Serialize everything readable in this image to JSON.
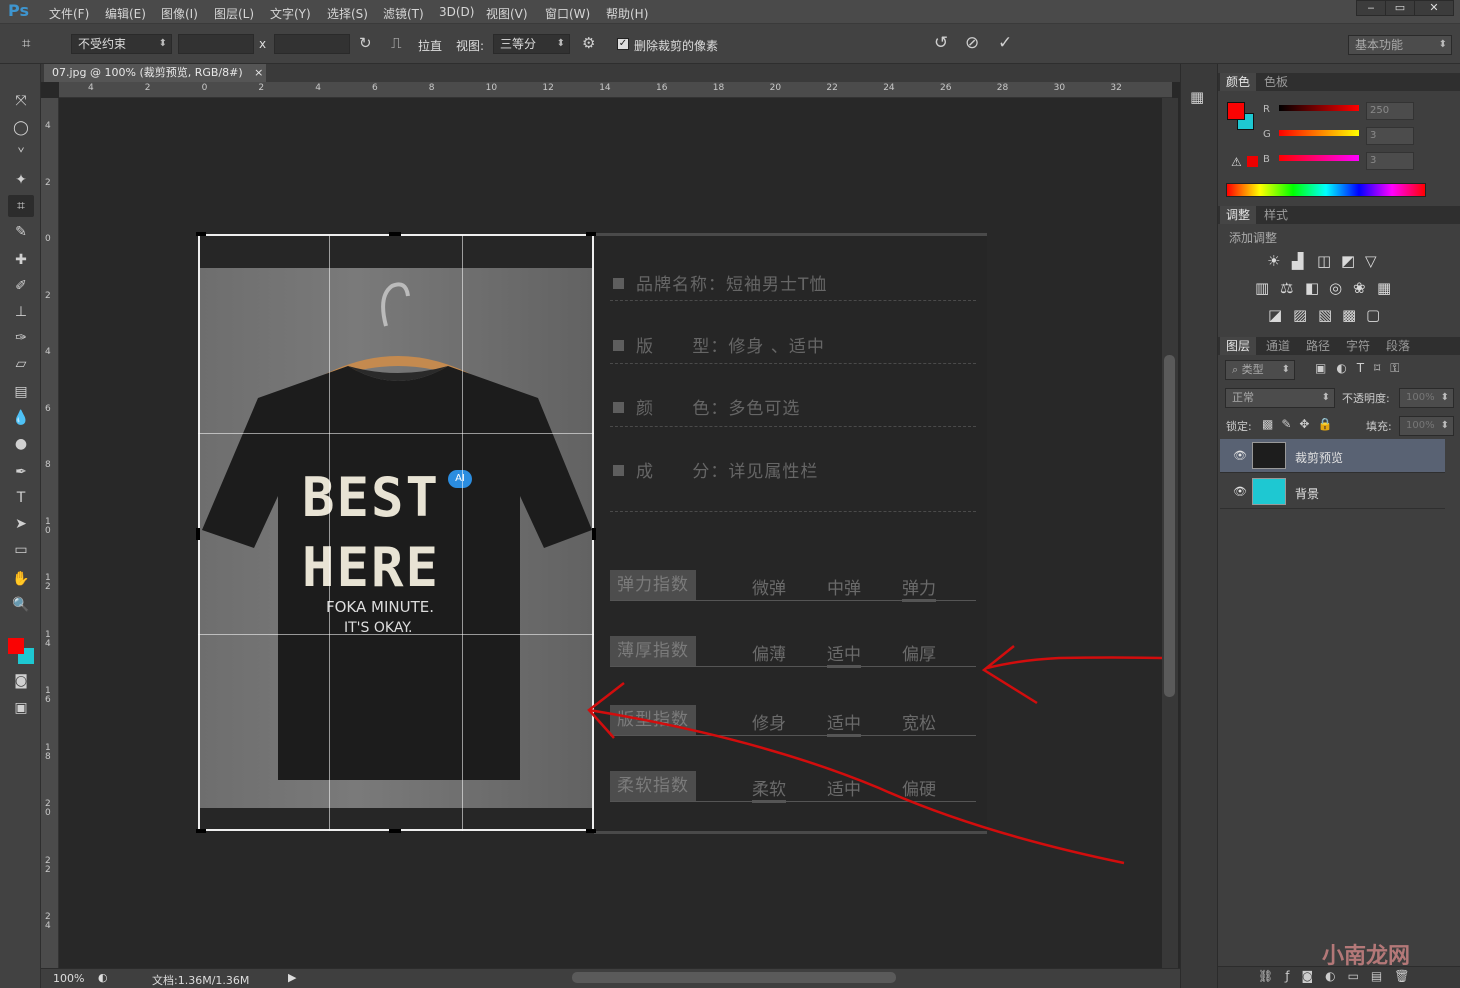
{
  "app": {
    "logo": "Ps"
  },
  "menubar": {
    "items": [
      "文件(F)",
      "编辑(E)",
      "图像(I)",
      "图层(L)",
      "文字(Y)",
      "选择(S)",
      "滤镜(T)",
      "3D(D)",
      "视图(V)",
      "窗口(W)",
      "帮助(H)"
    ],
    "window_buttons": [
      "‒",
      "▭",
      "✕"
    ]
  },
  "options": {
    "ratio": "不受约束",
    "x_label": "x",
    "straighten": "拉直",
    "view_label": "视图:",
    "view_value": "三等分",
    "delete_pixels": "删除裁剪的像素",
    "workspace": "基本功能"
  },
  "document": {
    "tab_title": "07.jpg @ 100% (裁剪预览, RGB/8#)",
    "tab_close": "×"
  },
  "rulers": {
    "h_labels": [
      "4",
      "2",
      "0",
      "2",
      "4",
      "6",
      "8",
      "10",
      "12",
      "14",
      "16",
      "18",
      "20",
      "22",
      "24",
      "26",
      "28",
      "30",
      "32"
    ],
    "v_labels": [
      "4",
      "2",
      "0",
      "2",
      "4",
      "6",
      "8",
      "1 0",
      "1 2",
      "1 4",
      "1 6",
      "1 8",
      "2 0",
      "2 2",
      "2 4"
    ]
  },
  "product": {
    "slogan1": "BEST",
    "slogan2": "HERE",
    "slogan3": "FOKA MINUTE.",
    "slogan4": "IT'S OKAY.",
    "badge": "AI"
  },
  "specs": [
    {
      "label": "品牌名称：短袖男士T恤"
    },
    {
      "label": "版      型：修身 、适中"
    },
    {
      "label": "颜      色：多色可选"
    },
    {
      "label": "成      分：详见属性栏"
    }
  ],
  "indices": [
    {
      "name": "弹力指数",
      "options": [
        "微弹",
        "中弹",
        "弹力"
      ],
      "selected": 2
    },
    {
      "name": "薄厚指数",
      "options": [
        "偏薄",
        "适中",
        "偏厚"
      ],
      "selected": 1
    },
    {
      "name": "版型指数",
      "options": [
        "修身",
        "适中",
        "宽松"
      ],
      "selected": 1
    },
    {
      "name": "柔软指数",
      "options": [
        "柔软",
        "适中",
        "偏硬"
      ],
      "selected": 0
    }
  ],
  "status": {
    "zoom": "100%",
    "doc_info": "文档:1.36M/1.36M"
  },
  "color_panel": {
    "tabs": [
      "颜色",
      "色板"
    ],
    "r_label": "R",
    "g_label": "G",
    "b_label": "B",
    "r": "250",
    "g": "3",
    "b": "3",
    "fg_color": "#fa0303",
    "bg_color": "#1ec8d2"
  },
  "adjust_panel": {
    "tabs": [
      "调整",
      "样式"
    ],
    "add_label": "添加调整"
  },
  "layers_panel": {
    "tabs": [
      "图层",
      "通道",
      "路径",
      "字符",
      "段落"
    ],
    "filter": "类型",
    "blend": "正常",
    "opacity_label": "不透明度:",
    "opacity": "100%",
    "lock_label": "锁定:",
    "fill_label": "填充:",
    "fill": "100%",
    "layers": [
      {
        "name": "裁剪预览",
        "selected": true
      },
      {
        "name": "背景",
        "selected": false
      }
    ]
  },
  "watermark": "小南龙网"
}
